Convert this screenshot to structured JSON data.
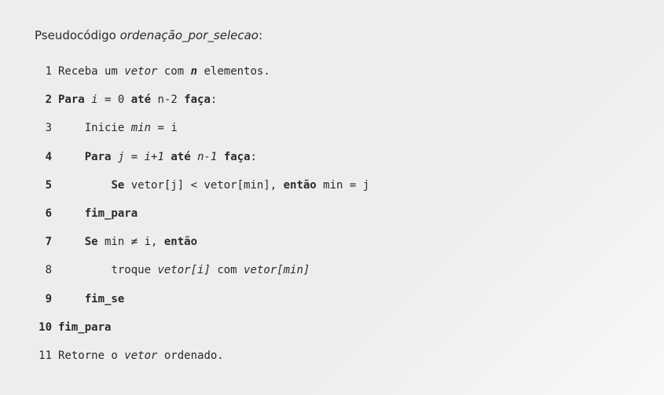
{
  "title": {
    "prefix": "Pseudocódigo ",
    "name": "ordenação_por_selecao",
    "suffix": ":"
  },
  "lines": [
    {
      "num": "1",
      "num_bold": false,
      "indent": 0,
      "segments": [
        {
          "text": "Receba um ",
          "style": ""
        },
        {
          "text": "vetor",
          "style": "i"
        },
        {
          "text": " com ",
          "style": ""
        },
        {
          "text": "n",
          "style": "bi"
        },
        {
          "text": " elementos.",
          "style": ""
        }
      ]
    },
    {
      "num": "2",
      "num_bold": true,
      "indent": 0,
      "segments": [
        {
          "text": "Para",
          "style": "b"
        },
        {
          "text": " ",
          "style": ""
        },
        {
          "text": "i",
          "style": "i"
        },
        {
          "text": " = 0 ",
          "style": ""
        },
        {
          "text": "até",
          "style": "b"
        },
        {
          "text": " n-2 ",
          "style": ""
        },
        {
          "text": "faça",
          "style": "b"
        },
        {
          "text": ":",
          "style": ""
        }
      ]
    },
    {
      "num": "3",
      "num_bold": false,
      "indent": 1,
      "segments": [
        {
          "text": "Inicie ",
          "style": ""
        },
        {
          "text": "min",
          "style": "i"
        },
        {
          "text": " = i",
          "style": ""
        }
      ]
    },
    {
      "num": "4",
      "num_bold": true,
      "indent": 1,
      "segments": [
        {
          "text": "Para",
          "style": "b"
        },
        {
          "text": " ",
          "style": ""
        },
        {
          "text": "j",
          "style": "i"
        },
        {
          "text": " = ",
          "style": ""
        },
        {
          "text": "i+1",
          "style": "i"
        },
        {
          "text": " ",
          "style": ""
        },
        {
          "text": "até",
          "style": "b"
        },
        {
          "text": " ",
          "style": ""
        },
        {
          "text": "n-1",
          "style": "i"
        },
        {
          "text": " ",
          "style": ""
        },
        {
          "text": "faça",
          "style": "b"
        },
        {
          "text": ":",
          "style": ""
        }
      ]
    },
    {
      "num": "5",
      "num_bold": true,
      "indent": 2,
      "segments": [
        {
          "text": "Se",
          "style": "b"
        },
        {
          "text": " vetor[j] < vetor[min], ",
          "style": ""
        },
        {
          "text": "então",
          "style": "b"
        },
        {
          "text": " min = j",
          "style": ""
        }
      ]
    },
    {
      "num": "6",
      "num_bold": true,
      "indent": 1,
      "segments": [
        {
          "text": "fim_para",
          "style": "b"
        }
      ]
    },
    {
      "num": "7",
      "num_bold": true,
      "indent": 1,
      "segments": [
        {
          "text": "Se",
          "style": "b"
        },
        {
          "text": " min ≠ i, ",
          "style": ""
        },
        {
          "text": "então",
          "style": "b"
        }
      ]
    },
    {
      "num": "8",
      "num_bold": false,
      "indent": 2,
      "segments": [
        {
          "text": "troque ",
          "style": ""
        },
        {
          "text": "vetor[i]",
          "style": "i"
        },
        {
          "text": " com ",
          "style": ""
        },
        {
          "text": "vetor[min]",
          "style": "i"
        }
      ]
    },
    {
      "num": "9",
      "num_bold": true,
      "indent": 1,
      "segments": [
        {
          "text": "fim_se",
          "style": "b"
        }
      ]
    },
    {
      "num": "10",
      "num_bold": true,
      "indent": 0,
      "segments": [
        {
          "text": "fim_para",
          "style": "b"
        }
      ]
    },
    {
      "num": "11",
      "num_bold": false,
      "indent": 0,
      "segments": [
        {
          "text": "Retorne o ",
          "style": ""
        },
        {
          "text": "vetor",
          "style": "i"
        },
        {
          "text": " ordenado.",
          "style": ""
        }
      ]
    }
  ],
  "indent_unit": "    "
}
